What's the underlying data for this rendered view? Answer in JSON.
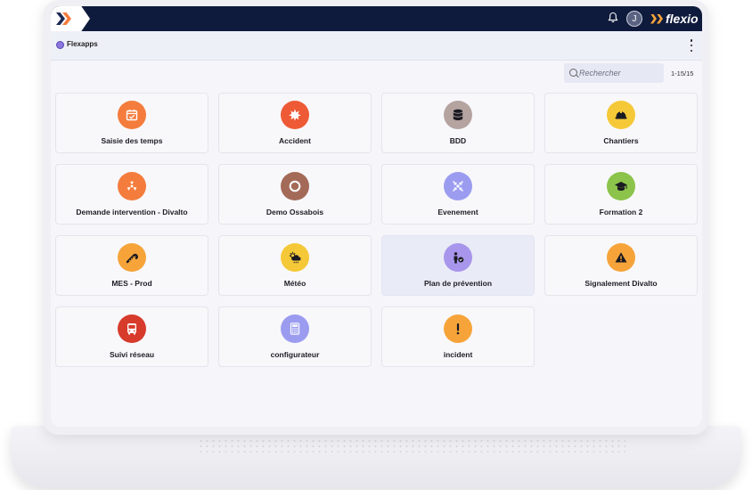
{
  "brand": {
    "name": "flexio"
  },
  "user": {
    "initial": "J"
  },
  "app": {
    "name": "Flexapps"
  },
  "search": {
    "placeholder": "Rechercher",
    "value": ""
  },
  "pagination": {
    "range": "1-15/15"
  },
  "cards": [
    {
      "label": "Saisie des temps",
      "icon": "calendar-check-icon",
      "color": "#f47c3c"
    },
    {
      "label": "Accident",
      "icon": "burst-icon",
      "color": "#ee5a35"
    },
    {
      "label": "BDD",
      "icon": "database-icon",
      "color": "#b5a3a0"
    },
    {
      "label": "Chantiers",
      "icon": "hard-hat-icon",
      "color": "#f5c838"
    },
    {
      "label": "Demande intervention - Divalto",
      "icon": "radiation-icon",
      "color": "#f47c3c"
    },
    {
      "label": "Demo Ossabois",
      "icon": "circle-ring-icon",
      "color": "#a46a58"
    },
    {
      "label": "Evenement",
      "icon": "arrows-converge-icon",
      "color": "#9b9cf0"
    },
    {
      "label": "Formation 2",
      "icon": "graduation-cap-icon",
      "color": "#8cc34a"
    },
    {
      "label": "MES - Prod",
      "icon": "candy-cane-icon",
      "color": "#f6a43a"
    },
    {
      "label": "Météo",
      "icon": "weather-storm-icon",
      "color": "#f5c838"
    },
    {
      "label": "Plan de prévention",
      "icon": "person-check-icon",
      "color": "#a896ec"
    },
    {
      "label": "Signalement Divalto",
      "icon": "warning-icon",
      "color": "#f6a43a"
    },
    {
      "label": "Suivi réseau",
      "icon": "bus-icon",
      "color": "#d73b2c"
    },
    {
      "label": "configurateur",
      "icon": "calculator-icon",
      "color": "#9b9cf0"
    },
    {
      "label": "incident",
      "icon": "exclamation-icon",
      "color": "#f6a43a"
    }
  ],
  "colors": {
    "topbar": "#0f1b3d",
    "accent_orange": "#f47c3c",
    "accent_yellow": "#f5c838"
  }
}
